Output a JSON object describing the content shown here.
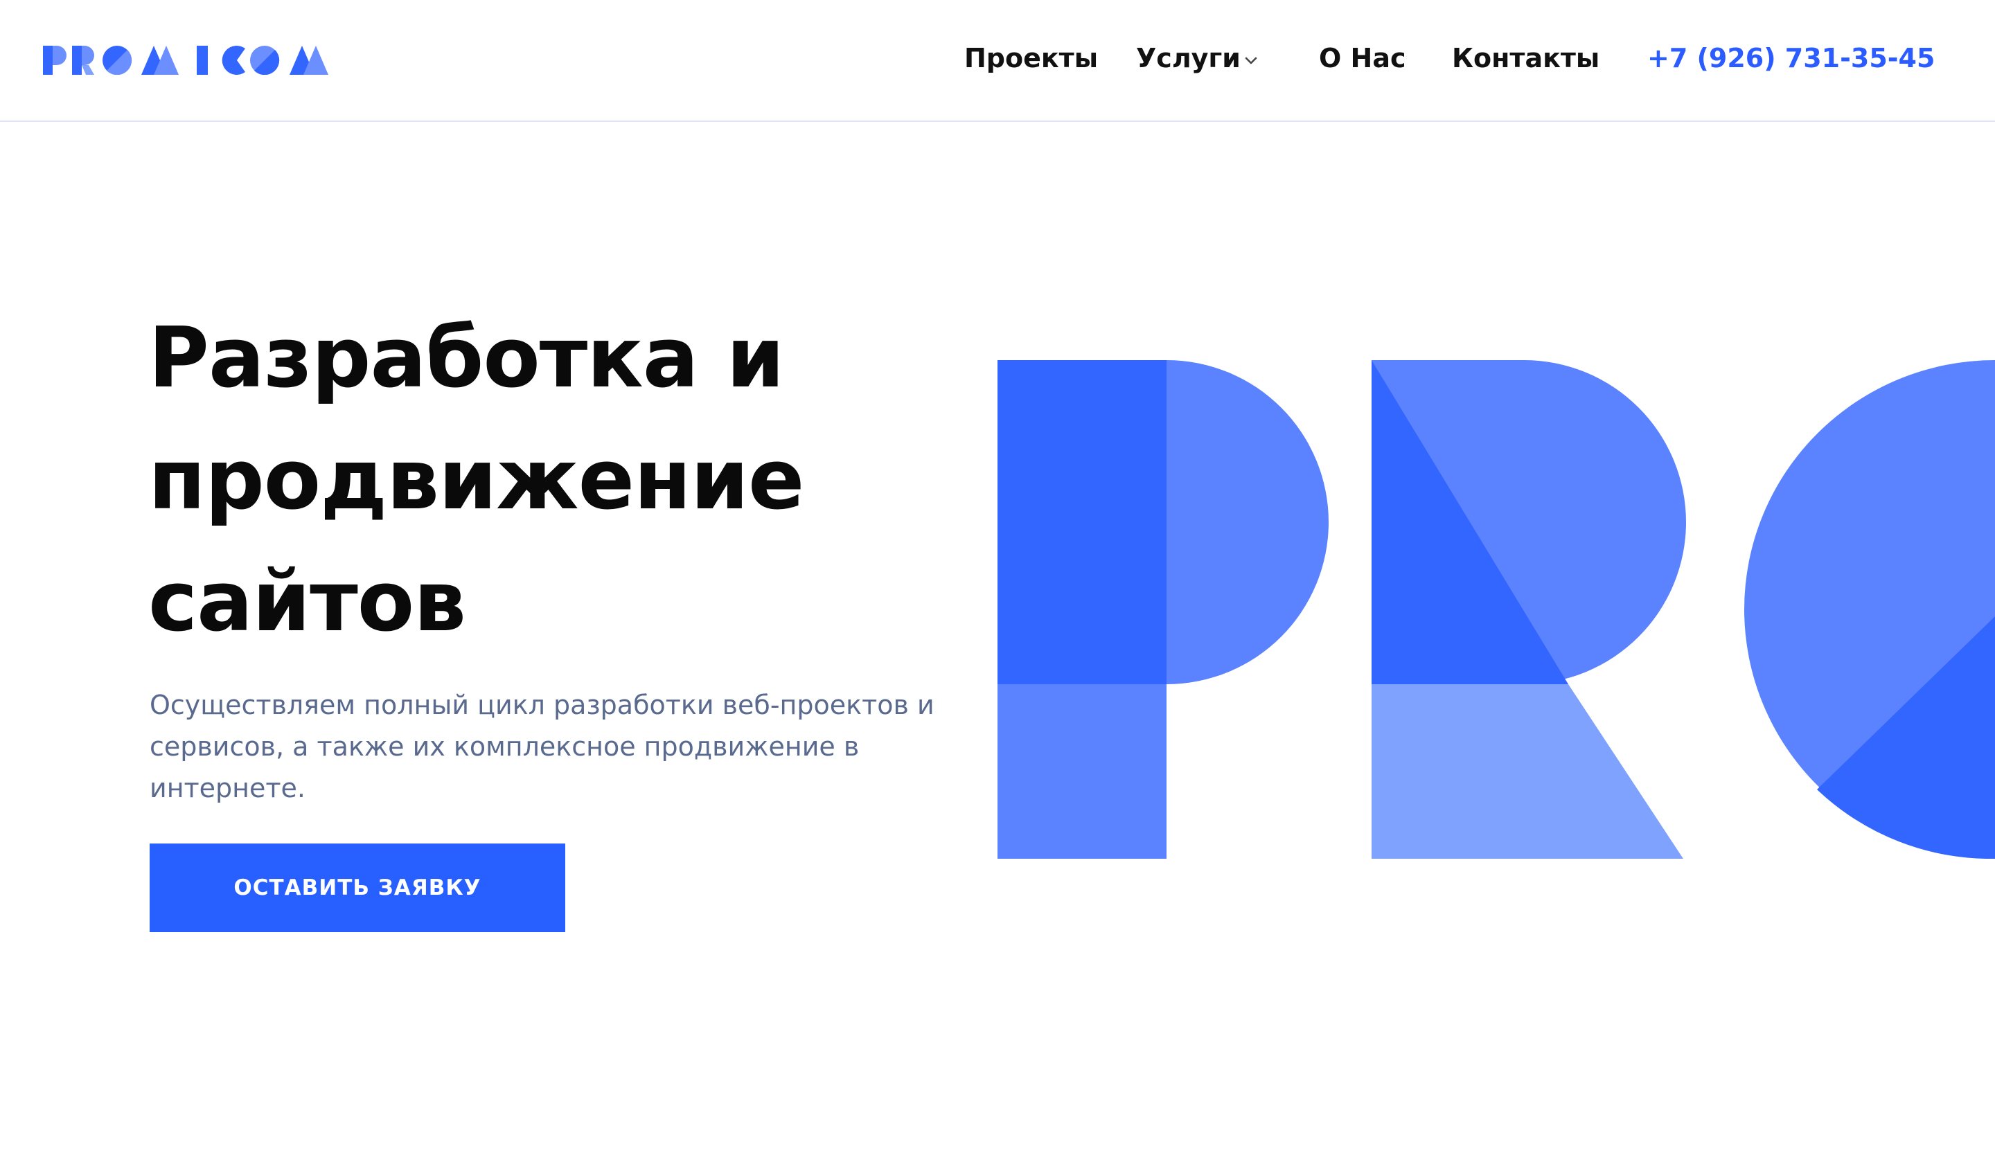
{
  "header": {
    "logo_text": "PROMICOM",
    "nav": [
      {
        "label": "Проекты"
      },
      {
        "label": "Услуги",
        "has_dropdown": true
      },
      {
        "label": "О Нас"
      },
      {
        "label": "Контакты"
      }
    ],
    "phone": "+7 (926) 731-35-45"
  },
  "hero": {
    "title_lines": [
      "Разработка и",
      "продвижение",
      "сайтов"
    ],
    "subtitle_lines": [
      "Осуществляем полный цикл разработки веб-проектов и",
      "сервисов, а также их комплексное продвижение в",
      "интернете."
    ],
    "cta_label": "ОСТАВИТЬ ЗАЯВКУ"
  },
  "colors": {
    "accent": "#2b5cff",
    "shape_dark": "#3366ff",
    "shape_mid": "#5b83ff",
    "shape_light": "#80a2ff",
    "text_dark": "#0a0a0a",
    "text_muted": "#5a6a8e"
  },
  "icons": {
    "dropdown": "chevron-down-icon"
  }
}
